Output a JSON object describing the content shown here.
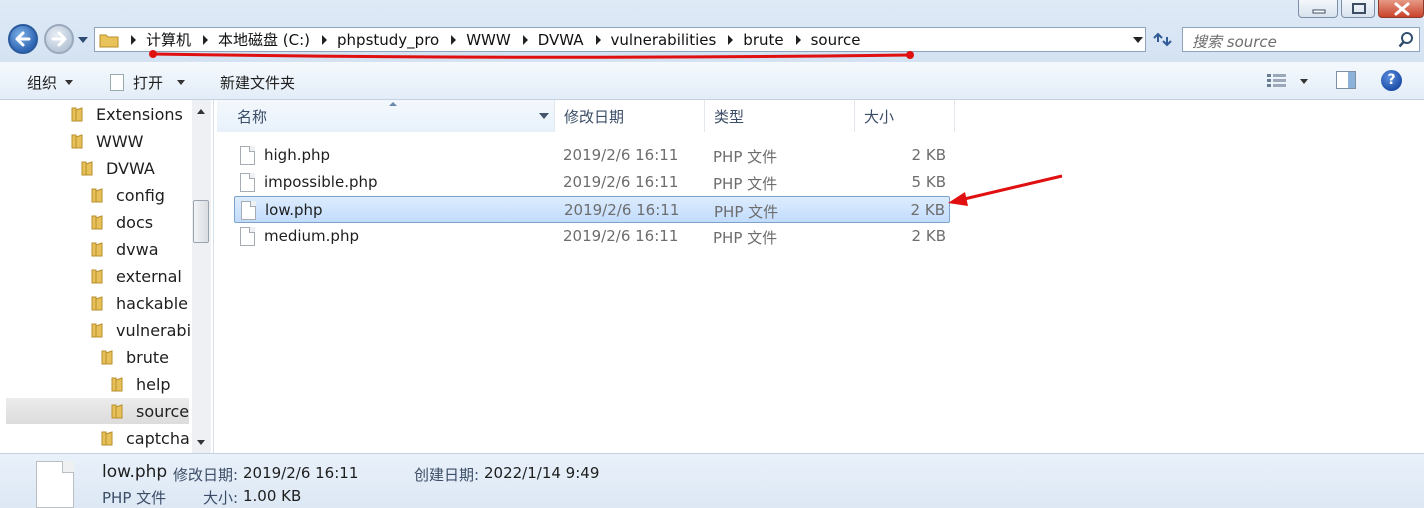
{
  "address": {
    "crumbs": [
      "计算机",
      "本地磁盘 (C:)",
      "phpstudy_pro",
      "WWW",
      "DVWA",
      "vulnerabilities",
      "brute",
      "source"
    ],
    "search_placeholder": "搜索 source"
  },
  "toolbar": {
    "organize": "组织",
    "open": "打开",
    "new_folder": "新建文件夹"
  },
  "tree": {
    "items": [
      {
        "label": "Extensions"
      },
      {
        "label": "WWW"
      },
      {
        "label": "DVWA"
      },
      {
        "label": "config"
      },
      {
        "label": "docs"
      },
      {
        "label": "dvwa"
      },
      {
        "label": "external"
      },
      {
        "label": "hackable"
      },
      {
        "label": "vulnerabiliti"
      },
      {
        "label": "brute"
      },
      {
        "label": "help"
      },
      {
        "label": "source"
      },
      {
        "label": "captcha"
      }
    ],
    "selected": "source"
  },
  "columns": {
    "name": "名称",
    "date": "修改日期",
    "type": "类型",
    "size": "大小"
  },
  "files": [
    {
      "name": "high.php",
      "date": "2019/2/6 16:11",
      "type": "PHP 文件",
      "size": "2 KB"
    },
    {
      "name": "impossible.php",
      "date": "2019/2/6 16:11",
      "type": "PHP 文件",
      "size": "5 KB"
    },
    {
      "name": "low.php",
      "date": "2019/2/6 16:11",
      "type": "PHP 文件",
      "size": "2 KB",
      "selected": true
    },
    {
      "name": "medium.php",
      "date": "2019/2/6 16:11",
      "type": "PHP 文件",
      "size": "2 KB"
    }
  ],
  "details": {
    "filename": "low.php",
    "modified_label": "修改日期:",
    "modified_value": "2019/2/6 16:11",
    "created_label": "创建日期:",
    "created_value": "2022/1/14 9:49",
    "type": "PHP 文件",
    "size_label": "大小:",
    "size_value": "1.00 KB"
  },
  "colors": {
    "annotation_red": "#e01010",
    "selection_fill": "#cce2fc",
    "window_bg": "#dfe9f5"
  }
}
